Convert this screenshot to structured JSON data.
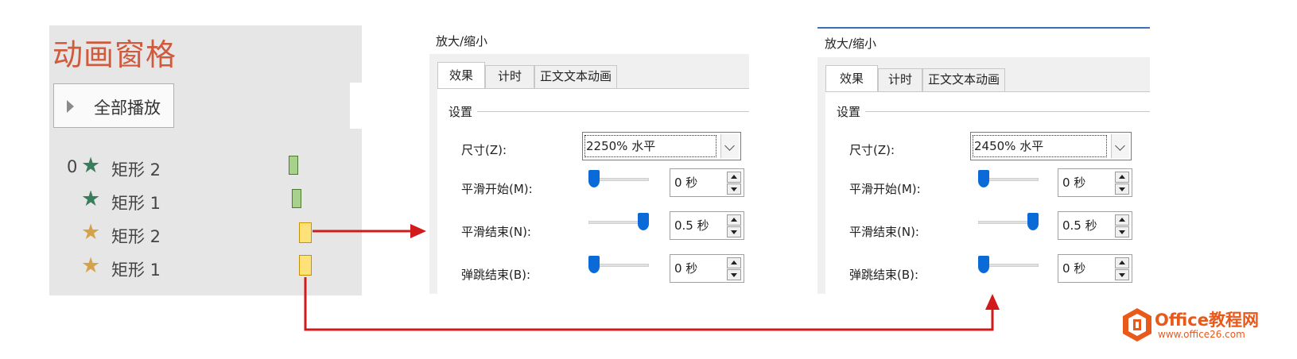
{
  "animation_pane": {
    "title": "动画窗格",
    "play_all_label": "全部播放",
    "items": [
      {
        "index": "0",
        "star": "green",
        "name": "矩形 2",
        "bar": "green"
      },
      {
        "index": "",
        "star": "green",
        "name": "矩形 1",
        "bar": "green"
      },
      {
        "index": "",
        "star": "gold",
        "name": "矩形 2",
        "bar": "gold"
      },
      {
        "index": "",
        "star": "gold",
        "name": "矩形 1",
        "bar": "gold"
      }
    ]
  },
  "dialog_left": {
    "title": "放大/缩小",
    "tabs": [
      "效果",
      "计时",
      "正文文本动画"
    ],
    "group_label": "设置",
    "size_label": "尺寸(Z):",
    "size_value": "2250% 水平",
    "smooth_start_label": "平滑开始(M):",
    "smooth_start_value": "0 秒",
    "smooth_end_label": "平滑结束(N):",
    "smooth_end_value": "0.5 秒",
    "bounce_end_label": "弹跳结束(B):",
    "bounce_end_value": "0 秒"
  },
  "dialog_right": {
    "title": "放大/缩小",
    "tabs": [
      "效果",
      "计时",
      "正文文本动画"
    ],
    "group_label": "设置",
    "size_label": "尺寸(Z):",
    "size_value": "2450% 水平",
    "smooth_start_label": "平滑开始(M):",
    "smooth_start_value": "0 秒",
    "smooth_end_label": "平滑结束(N):",
    "smooth_end_value": "0.5 秒",
    "bounce_end_label": "弹跳结束(B):",
    "bounce_end_value": "0 秒"
  },
  "logo": {
    "name": "Office教程网",
    "url": "www.office26.com"
  },
  "colors": {
    "title_red": "#d05a3c",
    "green_star": "#3a7d5c",
    "gold_star": "#d4a24a",
    "arrow_red": "#d11a1a",
    "slider_blue": "#0a6bd8",
    "logo_orange": "#e8591a"
  }
}
